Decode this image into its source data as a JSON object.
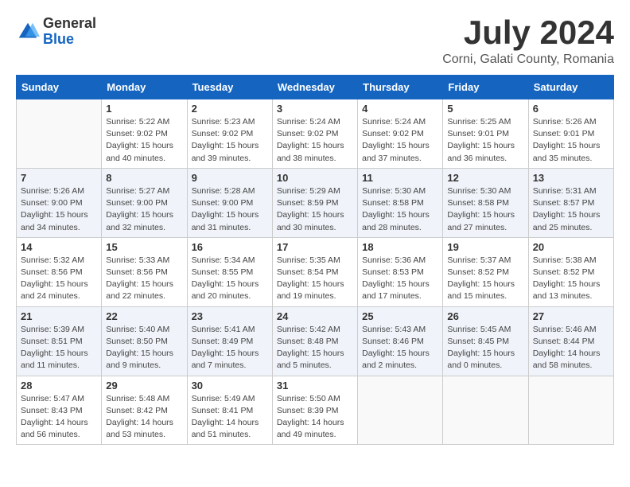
{
  "header": {
    "logo_general": "General",
    "logo_blue": "Blue",
    "month_title": "July 2024",
    "location": "Corni, Galati County, Romania"
  },
  "weekdays": [
    "Sunday",
    "Monday",
    "Tuesday",
    "Wednesday",
    "Thursday",
    "Friday",
    "Saturday"
  ],
  "weeks": [
    [
      {
        "day": "",
        "info": ""
      },
      {
        "day": "1",
        "info": "Sunrise: 5:22 AM\nSunset: 9:02 PM\nDaylight: 15 hours\nand 40 minutes."
      },
      {
        "day": "2",
        "info": "Sunrise: 5:23 AM\nSunset: 9:02 PM\nDaylight: 15 hours\nand 39 minutes."
      },
      {
        "day": "3",
        "info": "Sunrise: 5:24 AM\nSunset: 9:02 PM\nDaylight: 15 hours\nand 38 minutes."
      },
      {
        "day": "4",
        "info": "Sunrise: 5:24 AM\nSunset: 9:02 PM\nDaylight: 15 hours\nand 37 minutes."
      },
      {
        "day": "5",
        "info": "Sunrise: 5:25 AM\nSunset: 9:01 PM\nDaylight: 15 hours\nand 36 minutes."
      },
      {
        "day": "6",
        "info": "Sunrise: 5:26 AM\nSunset: 9:01 PM\nDaylight: 15 hours\nand 35 minutes."
      }
    ],
    [
      {
        "day": "7",
        "info": "Sunrise: 5:26 AM\nSunset: 9:00 PM\nDaylight: 15 hours\nand 34 minutes."
      },
      {
        "day": "8",
        "info": "Sunrise: 5:27 AM\nSunset: 9:00 PM\nDaylight: 15 hours\nand 32 minutes."
      },
      {
        "day": "9",
        "info": "Sunrise: 5:28 AM\nSunset: 9:00 PM\nDaylight: 15 hours\nand 31 minutes."
      },
      {
        "day": "10",
        "info": "Sunrise: 5:29 AM\nSunset: 8:59 PM\nDaylight: 15 hours\nand 30 minutes."
      },
      {
        "day": "11",
        "info": "Sunrise: 5:30 AM\nSunset: 8:58 PM\nDaylight: 15 hours\nand 28 minutes."
      },
      {
        "day": "12",
        "info": "Sunrise: 5:30 AM\nSunset: 8:58 PM\nDaylight: 15 hours\nand 27 minutes."
      },
      {
        "day": "13",
        "info": "Sunrise: 5:31 AM\nSunset: 8:57 PM\nDaylight: 15 hours\nand 25 minutes."
      }
    ],
    [
      {
        "day": "14",
        "info": "Sunrise: 5:32 AM\nSunset: 8:56 PM\nDaylight: 15 hours\nand 24 minutes."
      },
      {
        "day": "15",
        "info": "Sunrise: 5:33 AM\nSunset: 8:56 PM\nDaylight: 15 hours\nand 22 minutes."
      },
      {
        "day": "16",
        "info": "Sunrise: 5:34 AM\nSunset: 8:55 PM\nDaylight: 15 hours\nand 20 minutes."
      },
      {
        "day": "17",
        "info": "Sunrise: 5:35 AM\nSunset: 8:54 PM\nDaylight: 15 hours\nand 19 minutes."
      },
      {
        "day": "18",
        "info": "Sunrise: 5:36 AM\nSunset: 8:53 PM\nDaylight: 15 hours\nand 17 minutes."
      },
      {
        "day": "19",
        "info": "Sunrise: 5:37 AM\nSunset: 8:52 PM\nDaylight: 15 hours\nand 15 minutes."
      },
      {
        "day": "20",
        "info": "Sunrise: 5:38 AM\nSunset: 8:52 PM\nDaylight: 15 hours\nand 13 minutes."
      }
    ],
    [
      {
        "day": "21",
        "info": "Sunrise: 5:39 AM\nSunset: 8:51 PM\nDaylight: 15 hours\nand 11 minutes."
      },
      {
        "day": "22",
        "info": "Sunrise: 5:40 AM\nSunset: 8:50 PM\nDaylight: 15 hours\nand 9 minutes."
      },
      {
        "day": "23",
        "info": "Sunrise: 5:41 AM\nSunset: 8:49 PM\nDaylight: 15 hours\nand 7 minutes."
      },
      {
        "day": "24",
        "info": "Sunrise: 5:42 AM\nSunset: 8:48 PM\nDaylight: 15 hours\nand 5 minutes."
      },
      {
        "day": "25",
        "info": "Sunrise: 5:43 AM\nSunset: 8:46 PM\nDaylight: 15 hours\nand 2 minutes."
      },
      {
        "day": "26",
        "info": "Sunrise: 5:45 AM\nSunset: 8:45 PM\nDaylight: 15 hours\nand 0 minutes."
      },
      {
        "day": "27",
        "info": "Sunrise: 5:46 AM\nSunset: 8:44 PM\nDaylight: 14 hours\nand 58 minutes."
      }
    ],
    [
      {
        "day": "28",
        "info": "Sunrise: 5:47 AM\nSunset: 8:43 PM\nDaylight: 14 hours\nand 56 minutes."
      },
      {
        "day": "29",
        "info": "Sunrise: 5:48 AM\nSunset: 8:42 PM\nDaylight: 14 hours\nand 53 minutes."
      },
      {
        "day": "30",
        "info": "Sunrise: 5:49 AM\nSunset: 8:41 PM\nDaylight: 14 hours\nand 51 minutes."
      },
      {
        "day": "31",
        "info": "Sunrise: 5:50 AM\nSunset: 8:39 PM\nDaylight: 14 hours\nand 49 minutes."
      },
      {
        "day": "",
        "info": ""
      },
      {
        "day": "",
        "info": ""
      },
      {
        "day": "",
        "info": ""
      }
    ]
  ]
}
